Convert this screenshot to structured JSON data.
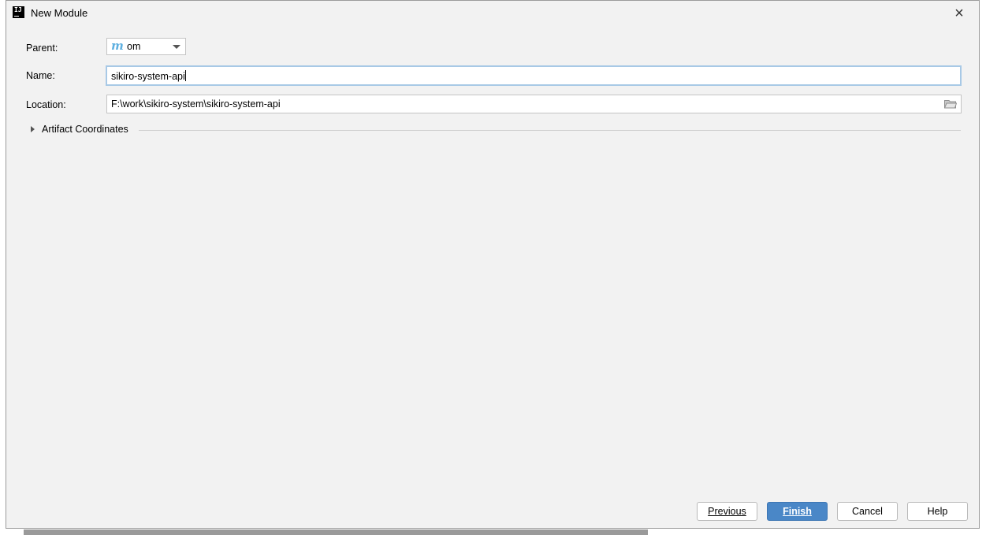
{
  "window": {
    "title": "New Module",
    "app_icon": "intellij-idea-icon",
    "app_icon_glyph": "IJ"
  },
  "form": {
    "parent": {
      "label": "Parent:",
      "value": "om",
      "icon": "maven-module-icon"
    },
    "name": {
      "label": "Name:",
      "value": "sikiro-system-api"
    },
    "location": {
      "label": "Location:",
      "value": "F:\\work\\sikiro-system\\sikiro-system-api",
      "browse_icon": "folder-icon"
    },
    "artifact_section": {
      "label": "Artifact Coordinates",
      "expanded": false
    }
  },
  "buttons": {
    "previous": "Previous",
    "finish": "Finish",
    "cancel": "Cancel",
    "help": "Help"
  },
  "colors": {
    "primary_button": "#4a87c7",
    "focus_border": "#a8c9e6",
    "maven_icon": "#5fb0e0"
  }
}
